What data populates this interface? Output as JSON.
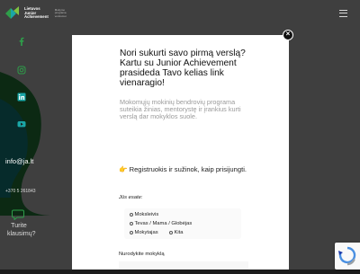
{
  "header": {
    "logo_line1": "Lietuvos",
    "logo_line2": "Junior",
    "logo_line3": "Achievement",
    "logo_subtitle": "Mokymo programa verslumui"
  },
  "sidebar": {
    "email": "info@ja.lt",
    "phone": "+370 5 261843",
    "ask_line1": "Turite",
    "ask_line2": "klausimų?"
  },
  "modal": {
    "title": "Nori sukurti savo pirmą verslą? Kartu su Junior Achievement prasideda Tavo kelias link vienaragio!",
    "description": "Mokomųjų mokinių bendrovių programa suteikia žinias, mentorystę ir įrankius kurti verslą dar mokyklos suole.",
    "cta_icon": "👉",
    "cta": "Registruokis ir sužinok, kaip prisijungti.",
    "role_label": "Jūs esate:",
    "roles": [
      "Moksleivis",
      "Tevas / Mama / Globėjas",
      "Mokytajas",
      "Kita"
    ],
    "school_label": "Nurodykite mokyklą",
    "school_placeholder": ""
  },
  "icons": {
    "facebook": "facebook-icon",
    "instagram": "instagram-icon",
    "linkedin": "linkedin-icon",
    "youtube": "youtube-icon",
    "close": "close-icon",
    "chat": "chat-icon",
    "recaptcha": "recaptcha-icon"
  },
  "colors": {
    "brand_green": "#2e9e4a",
    "brand_teal": "#1aa6a6",
    "overlay": "#000000",
    "accent_yellow": "#f2b01f"
  }
}
